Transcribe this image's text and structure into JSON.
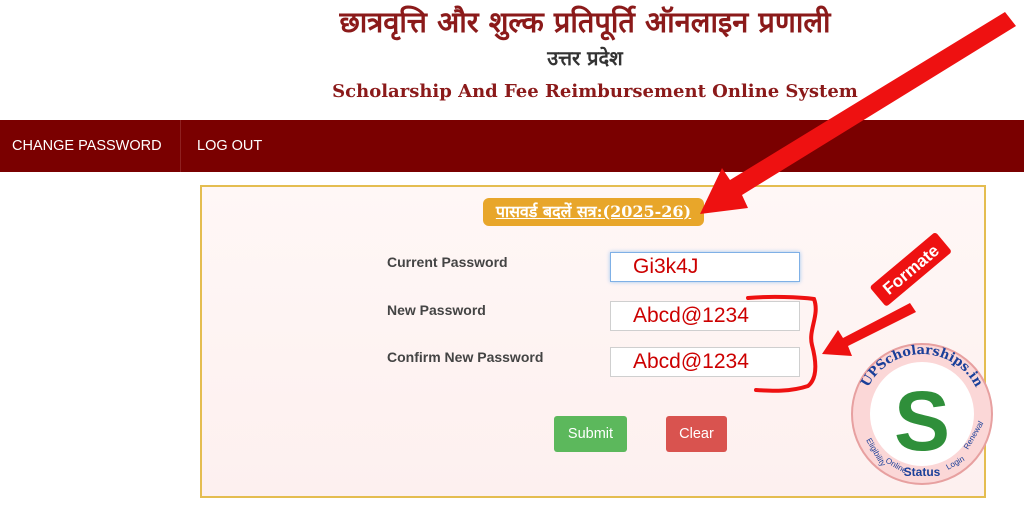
{
  "header": {
    "title_hindi": "छात्रवृत्ति और शुल्क प्रतिपूर्ति ऑनलाइन प्रणाली",
    "state": "उत्तर प्रदेश",
    "title_english": "Scholarship And Fee Reimbursement Online System"
  },
  "nav": {
    "change_password": "CHANGE PASSWORD",
    "logout": "LOG OUT"
  },
  "form": {
    "title": "पासवर्ड बदलें सत्र:(2025-26)",
    "current_label": "Current Password",
    "current_value": "Gi3k4J",
    "new_label": "New Password",
    "new_value": "Abcd@1234",
    "confirm_label": "Confirm New Password",
    "confirm_value": "Abcd@1234",
    "submit": "Submit",
    "clear": "Clear"
  },
  "annotation": {
    "formate_label": "Formate"
  },
  "watermark": {
    "site": "UPScholarships.in",
    "letter": "S",
    "status": "Status",
    "words": [
      "Eligibility",
      "Online",
      "Login",
      "Renewal"
    ]
  },
  "colors": {
    "maroon": "#7a0000",
    "title_red": "#8b1a1a",
    "badge_orange": "#e8a62a",
    "submit_green": "#5cb85c",
    "clear_red": "#d9534f",
    "arrow_red": "#ee1111"
  }
}
